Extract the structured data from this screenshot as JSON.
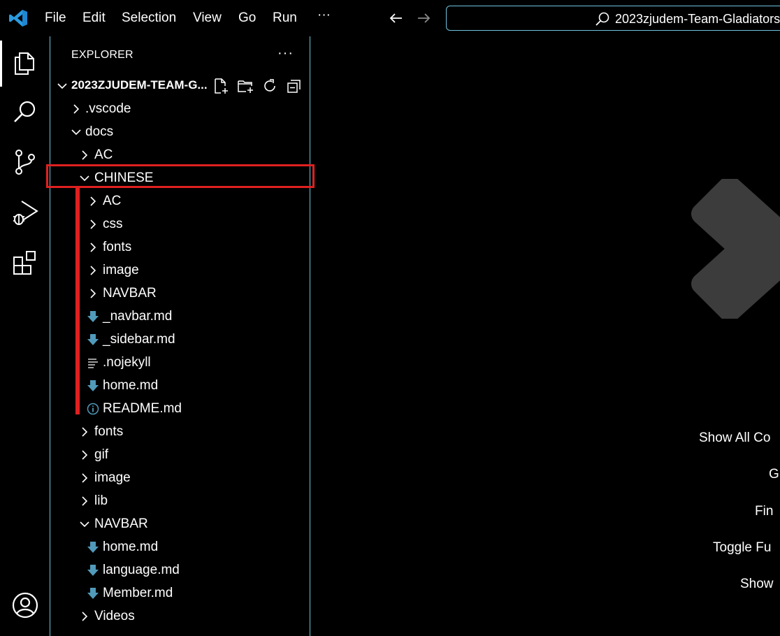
{
  "titlebar": {
    "menu": [
      "File",
      "Edit",
      "Selection",
      "View",
      "Go",
      "Run",
      "···"
    ],
    "command_center_text": "2023zjudem-Team-Gladiators"
  },
  "activitybar": {
    "items": [
      "explorer-icon",
      "search-icon",
      "source-control-icon",
      "run-debug-icon",
      "extensions-icon"
    ],
    "bottom": [
      "account-icon"
    ]
  },
  "sidebar": {
    "title": "EXPLORER",
    "more": "···",
    "root_label": "2023ZJUDEM-TEAM-G...",
    "tree": [
      {
        "label": ".vscode",
        "indent": 1,
        "kind": "folder-closed"
      },
      {
        "label": "docs",
        "indent": 1,
        "kind": "folder-open"
      },
      {
        "label": "AC",
        "indent": 2,
        "kind": "folder-closed"
      },
      {
        "label": "CHINESE",
        "indent": 2,
        "kind": "folder-open"
      },
      {
        "label": "AC",
        "indent": 3,
        "kind": "folder-closed"
      },
      {
        "label": "css",
        "indent": 3,
        "kind": "folder-closed"
      },
      {
        "label": "fonts",
        "indent": 3,
        "kind": "folder-closed"
      },
      {
        "label": "image",
        "indent": 3,
        "kind": "folder-closed"
      },
      {
        "label": "NAVBAR",
        "indent": 3,
        "kind": "folder-closed"
      },
      {
        "label": "_navbar.md",
        "indent": 3,
        "kind": "markdown"
      },
      {
        "label": "_sidebar.md",
        "indent": 3,
        "kind": "markdown"
      },
      {
        "label": ".nojekyll",
        "indent": 3,
        "kind": "text"
      },
      {
        "label": "home.md",
        "indent": 3,
        "kind": "markdown"
      },
      {
        "label": "README.md",
        "indent": 3,
        "kind": "info"
      },
      {
        "label": "fonts",
        "indent": 2,
        "kind": "folder-closed"
      },
      {
        "label": "gif",
        "indent": 2,
        "kind": "folder-closed"
      },
      {
        "label": "image",
        "indent": 2,
        "kind": "folder-closed"
      },
      {
        "label": "lib",
        "indent": 2,
        "kind": "folder-closed"
      },
      {
        "label": "NAVBAR",
        "indent": 2,
        "kind": "folder-open"
      },
      {
        "label": "home.md",
        "indent": 3,
        "kind": "markdown"
      },
      {
        "label": "language.md",
        "indent": 3,
        "kind": "markdown"
      },
      {
        "label": "Member.md",
        "indent": 3,
        "kind": "markdown"
      },
      {
        "label": "Videos",
        "indent": 2,
        "kind": "folder-closed"
      }
    ]
  },
  "editor": {
    "shortcuts": [
      "Show All Co",
      "G",
      "Fin",
      "Toggle Fu",
      "Show"
    ]
  },
  "colors": {
    "focus_border": "#6fc3df",
    "annotation_red": "#e02020",
    "markdown_icon": "#519aba",
    "watermark": "#3c3c3c"
  }
}
